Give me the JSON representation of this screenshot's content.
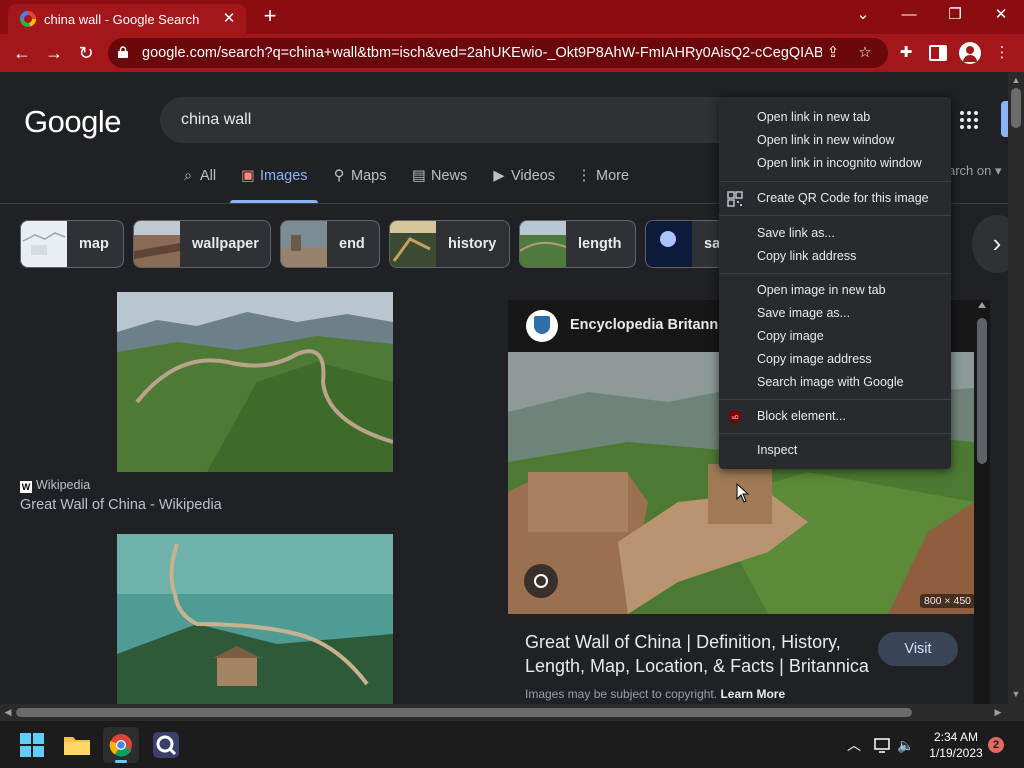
{
  "browser": {
    "tab_title": "china wall - Google Search",
    "tab_close": "✕",
    "new_tab": "+",
    "url": "google.com/search?q=china+wall&tbm=isch&ved=2ahUKEwio-_Okt9P8AhW-FmIAHRy0AisQ2-cCegQIABA...",
    "accent_color": "#a3171b"
  },
  "google": {
    "logo": "Google",
    "query": "china wall",
    "search_on": "arch on",
    "tabs": [
      {
        "label": "All",
        "icon": "search-icon"
      },
      {
        "label": "Images",
        "icon": "images-icon"
      },
      {
        "label": "Maps",
        "icon": "map-pin-icon"
      },
      {
        "label": "News",
        "icon": "news-icon"
      },
      {
        "label": "Videos",
        "icon": "video-icon"
      },
      {
        "label": "More",
        "icon": "more-vertical-icon"
      }
    ],
    "chips": [
      "map",
      "wallpaper",
      "end",
      "history",
      "length",
      "sa"
    ]
  },
  "results": [
    {
      "source": "Wikipedia",
      "title": "Great Wall of China - Wikipedia"
    }
  ],
  "preview": {
    "source": "Encyclopedia Britannic",
    "dimensions": "800 × 450",
    "title": "Great Wall of China | Definition, History, Length, Map, Location, & Facts | Britannica",
    "visit_label": "Visit",
    "copyright_text": "Images may be subject to copyright.",
    "learn_more": "Learn More"
  },
  "context_menu": {
    "items": [
      "Open link in new tab",
      "Open link in new window",
      "Open link in incognito window",
      "Create QR Code for this image",
      "Save link as...",
      "Copy link address",
      "Open image in new tab",
      "Save image as...",
      "Copy image",
      "Copy image address",
      "Search image with Google",
      "Block element...",
      "Inspect"
    ]
  },
  "taskbar": {
    "time": "2:34 AM",
    "date": "1/19/2023",
    "notification_count": "2"
  }
}
